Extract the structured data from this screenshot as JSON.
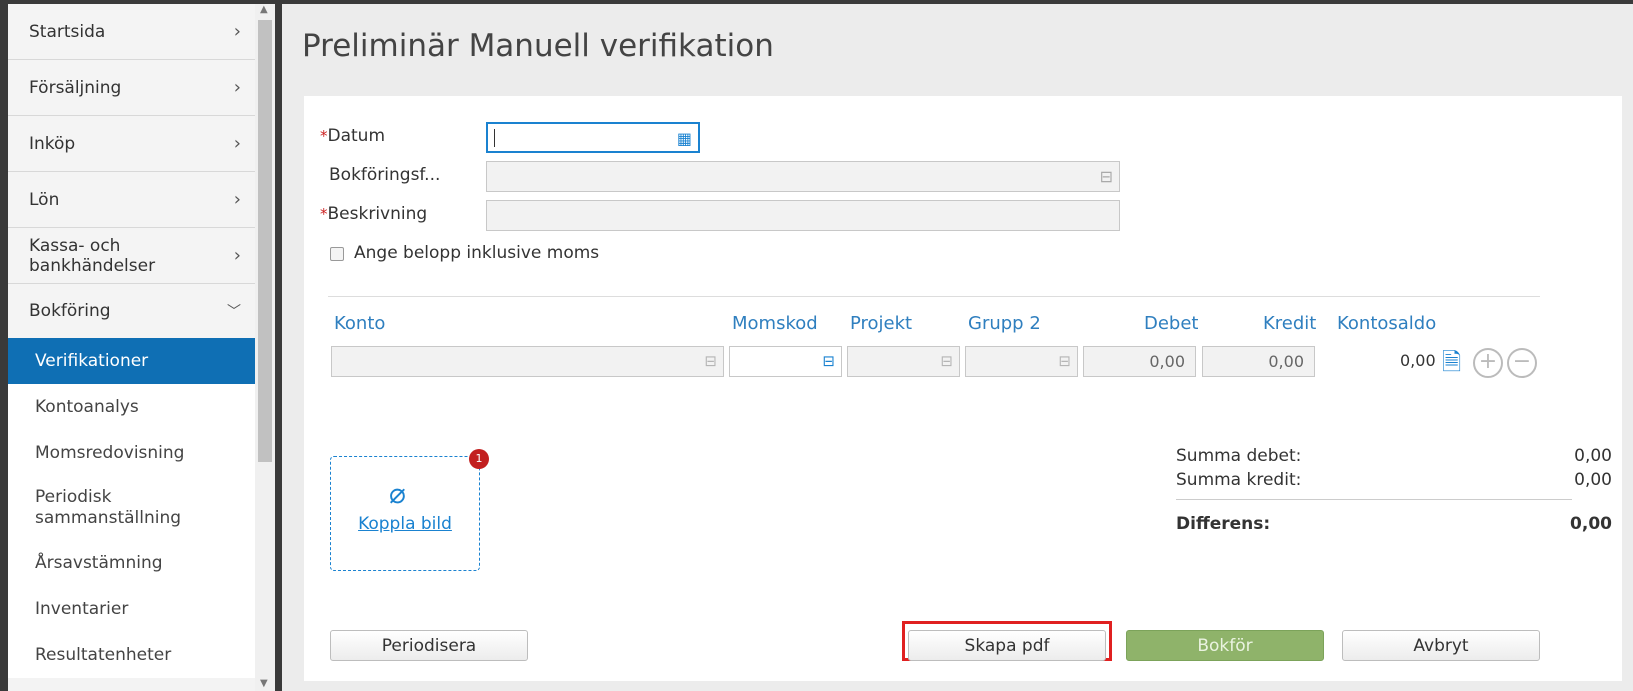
{
  "sidebar": {
    "items": [
      {
        "label": "Startsida",
        "chevron": "chevron-right"
      },
      {
        "label": "Försäljning",
        "chevron": "chevron-right"
      },
      {
        "label": "Inköp",
        "chevron": "chevron-right"
      },
      {
        "label": "Lön",
        "chevron": "chevron-right"
      },
      {
        "label": "Kassa- och bankhändelser",
        "chevron": "chevron-right"
      },
      {
        "label": "Bokföring",
        "chevron": "chevron-down"
      }
    ],
    "subitems": [
      {
        "label": "Verifikationer",
        "active": true
      },
      {
        "label": "Kontoanalys"
      },
      {
        "label": "Momsredovisning"
      },
      {
        "label": "Periodisk sammanställning"
      },
      {
        "label": "Årsavstämning"
      },
      {
        "label": "Inventarier"
      },
      {
        "label": "Resultatenheter"
      }
    ]
  },
  "page": {
    "title": "Preliminär Manuell verifikation"
  },
  "form": {
    "datum_label": "Datum",
    "datum_value": "",
    "bokforingsf_label": "Bokföringsf...",
    "beskrivning_label": "Beskrivning",
    "required_mark": "*",
    "inkl_moms_label": "Ange belopp inklusive moms",
    "inkl_moms_checked": false
  },
  "table": {
    "headers": {
      "konto": "Konto",
      "momskod": "Momskod",
      "projekt": "Projekt",
      "grupp2": "Grupp 2",
      "debet": "Debet",
      "kredit": "Kredit",
      "kontosaldo": "Kontosaldo"
    },
    "row": {
      "debet": "0,00",
      "kredit": "0,00",
      "kontosaldo": "0,00"
    }
  },
  "attach": {
    "link": "Koppla bild",
    "badge": "1"
  },
  "summary": {
    "debet_label": "Summa debet:",
    "debet_value": "0,00",
    "kredit_label": "Summa kredit:",
    "kredit_value": "0,00",
    "diff_label": "Differens:",
    "diff_value": "0,00"
  },
  "footer": {
    "periodisera": "Periodisera",
    "skapa_pdf": "Skapa pdf",
    "bokfor": "Bokför",
    "avbryt": "Avbryt"
  },
  "colors": {
    "accent": "#0f6fb4",
    "header_blue": "#2f7fbf",
    "green_button": "#8fb36a",
    "highlight_red": "#e02020",
    "required_red": "#cc2222"
  }
}
